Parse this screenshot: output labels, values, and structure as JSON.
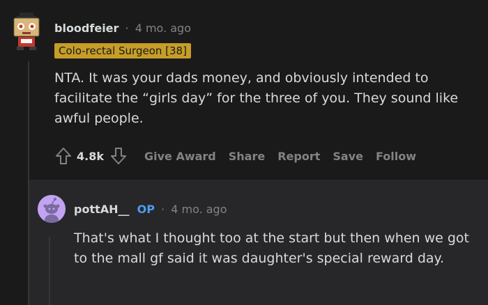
{
  "comment1": {
    "username": "bloodfeier",
    "separator": "·",
    "time": "4 mo. ago",
    "flair": "Colo-rectal Surgeon [38]",
    "body": "NTA. It was your dads money, and obviously intended to facilitate the “girls day” for the three of you. They sound like awful people.",
    "score": "4.8k",
    "actions": {
      "give_award": "Give Award",
      "share": "Share",
      "report": "Report",
      "save": "Save",
      "follow": "Follow"
    }
  },
  "comment2": {
    "username": "pottAH__",
    "op_badge": "OP",
    "separator": "·",
    "time": "4 mo. ago",
    "body": "That's what I thought too at the start but then when we got to the mall gf said it was daughter's special reward day."
  },
  "colors": {
    "background": "#1a1a1b",
    "reply_background": "#272729",
    "flair": "#c69d27",
    "op": "#4f9bf0",
    "avatar2": "#c2a3f2"
  },
  "icons": {
    "upvote": "upvote-arrow-icon",
    "downvote": "downvote-arrow-icon",
    "avatar1": "robot-box-avatar-icon",
    "avatar2": "snoo-avatar-icon"
  }
}
